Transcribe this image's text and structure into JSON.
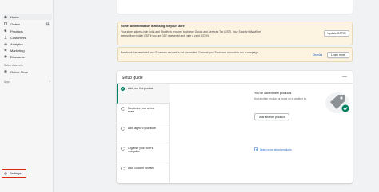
{
  "sidebar": {
    "items": [
      {
        "label": "Home",
        "icon": "home-icon",
        "active": true
      },
      {
        "label": "Orders",
        "icon": "orders-icon",
        "badge": "11"
      },
      {
        "label": "Products",
        "icon": "tag-icon"
      },
      {
        "label": "Customers",
        "icon": "person-icon"
      },
      {
        "label": "Analytics",
        "icon": "analytics-icon"
      },
      {
        "label": "Marketing",
        "icon": "marketing-icon"
      },
      {
        "label": "Discounts",
        "icon": "discount-icon"
      }
    ],
    "sales_channels_label": "Sales channels",
    "online_store_label": "Online Store",
    "apps_label": "Apps",
    "settings_label": "Settings"
  },
  "banners": {
    "tax": {
      "title": "Some tax information is missing for your store",
      "text": "Your store address is in India and Shopify is required to charge Goods and Services Tax (GST). Your Shopify bills will be exempt from Indian GST if you are GST registered and enter a valid GSTIN.",
      "button": "Update GSTIN"
    },
    "facebook": {
      "text": "Facebook has restricted your Facebook account is not connected. Connect your Facebook account to run a campaign.",
      "dismiss": "Dismiss",
      "button": "Learn more"
    }
  },
  "setup_guide": {
    "title": "Setup guide",
    "collapse": "—",
    "steps": [
      {
        "label": "Add your first product",
        "done": true
      },
      {
        "label": "Customize your online store",
        "done": false
      },
      {
        "label": "Add pages to your store",
        "done": false
      },
      {
        "label": "Organize your store's navigation",
        "done": false
      },
      {
        "label": "Add a custom domain",
        "done": false
      }
    ],
    "panel": {
      "title": "You've added new products",
      "text": "Add another product or move on to another tip.",
      "button": "Add another product",
      "link": "Learn more about products"
    }
  },
  "colors": {
    "accent": "#008060",
    "link": "#2c6ecb",
    "highlight": "#d72c0d",
    "banner_bg": "#fdf3e1"
  }
}
